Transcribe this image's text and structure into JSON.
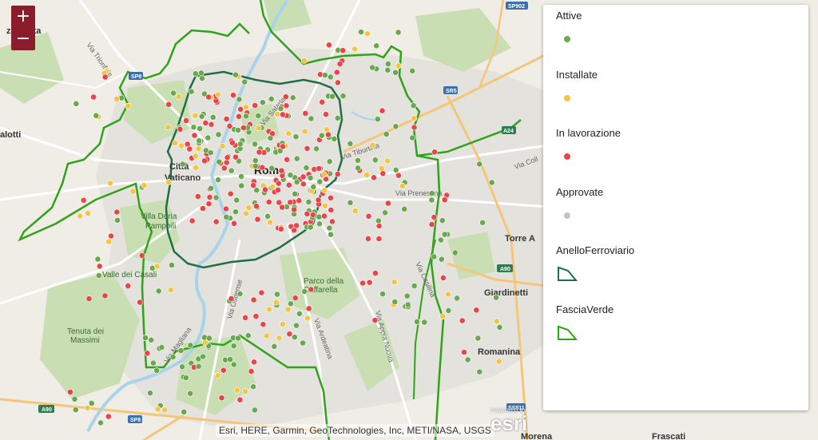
{
  "map": {
    "place_labels": {
      "roma": "Roma",
      "citta_vaticano_1": "Città",
      "citta_vaticano_2": "Vaticano",
      "villa_doria_1": "Villa Doria",
      "villa_doria_2": "Pamphili",
      "valle_dei_casali": "Valle dei Casali",
      "tenuta_1": "Tenuta dei",
      "tenuta_2": "Massimi",
      "parco_1": "Parco della",
      "parco_2": "Caffarella",
      "torre_a": "Torre A",
      "giardinetti": "Giardinetti",
      "romanina": "Romanina",
      "frascati": "Frascati",
      "morena": "Morena",
      "palotti": "alotti",
      "ozzanetta": "zzanetta"
    },
    "road_labels": {
      "trionfale": "Via Trionfale",
      "salaria": "Via Salaria",
      "tiburtina": "Via Tiburtina",
      "prenestina": "Via Prenestina",
      "casilina": "Via Casilina",
      "appia_nuova": "Via Appia Nuova",
      "ardeatina": "Via Ardeatina",
      "ostiense": "Via Ostiense",
      "magliana": "Via Magliana",
      "collatina": "Via Coll"
    },
    "shields": {
      "sp902": "SP902",
      "sr5": "SR5",
      "sp8": "SP8",
      "a90_west": "A90",
      "a90_east": "A90",
      "sss11": "SS511",
      "a24": "A24"
    },
    "colors": {
      "attive": "#6aa84f",
      "installate": "#f4c542",
      "in_lavorazione": "#e8444a",
      "approvate": "#c4c4c4",
      "anello": "#1f6e46",
      "fascia": "#2fa31a"
    }
  },
  "zoom": {
    "in_label": "+",
    "out_label": "−"
  },
  "legend": {
    "items": [
      {
        "label": "Attive",
        "color": "#6aa84f"
      },
      {
        "label": "Installate",
        "color": "#f4c542"
      },
      {
        "label": "In lavorazione",
        "color": "#e8444a"
      },
      {
        "label": "Approvate",
        "color": "#c4c4c4"
      }
    ],
    "polygons": [
      {
        "label": "AnelloFerroviario",
        "color": "#1f6e46"
      },
      {
        "label": "FasciaVerde",
        "color": "#2fa31a"
      }
    ]
  },
  "attribution": "Esri, HERE, Garmin, GeoTechnologies, Inc, METI/NASA, USGS",
  "esri": {
    "powered": "POWERED BY",
    "word": "esri"
  }
}
